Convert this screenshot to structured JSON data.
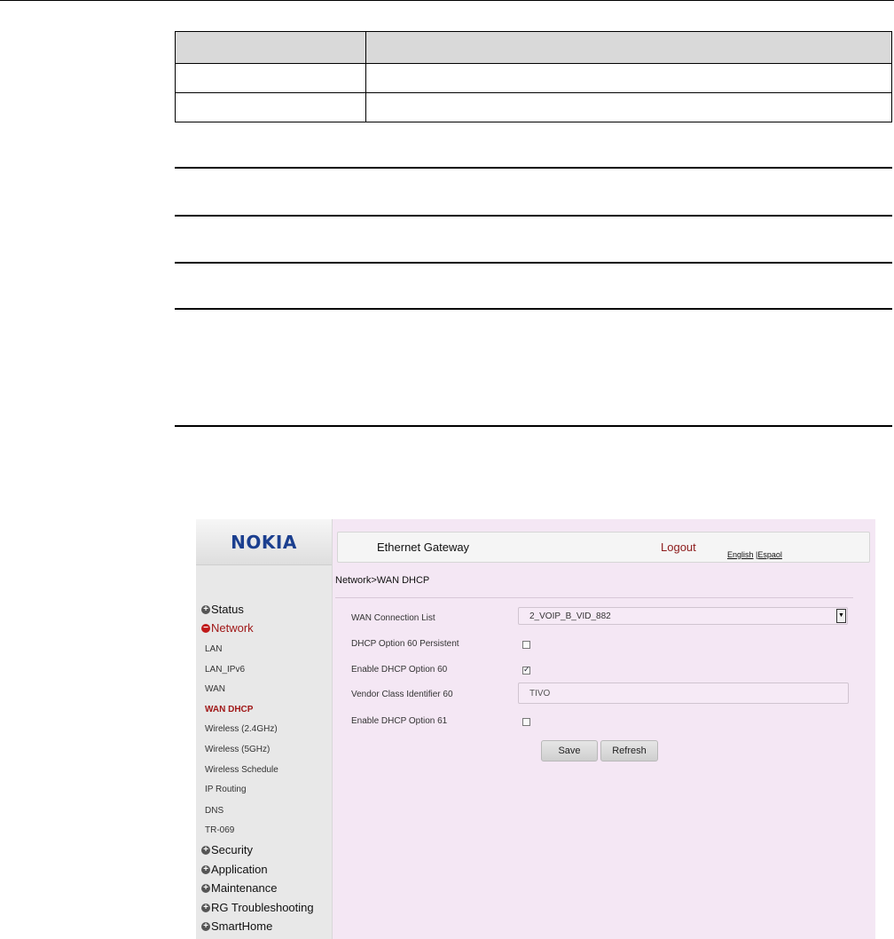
{
  "app": {
    "logo": "NOKIA",
    "title": "Ethernet Gateway",
    "logout": "Logout",
    "lang_english": "English",
    "lang_sep": " |",
    "lang_spanish": "Espaol"
  },
  "breadcrumb": "Network>WAN DHCP",
  "sidebar": {
    "status": "Status",
    "network": "Network",
    "sub": [
      "LAN",
      "LAN_IPv6",
      "WAN",
      "WAN DHCP",
      "Wireless (2.4GHz)",
      "Wireless (5GHz)",
      "Wireless Schedule",
      "IP Routing",
      "DNS",
      "TR-069"
    ],
    "active_sub": "WAN DHCP",
    "security": "Security",
    "application": "Application",
    "maintenance": "Maintenance",
    "troubleshooting": "RG Troubleshooting",
    "smarthome": "SmartHome"
  },
  "form": {
    "wan_list_label": "WAN Connection List",
    "wan_list_value": "2_VOIP_B_VID_882",
    "opt60_persistent_label": "DHCP Option 60 Persistent",
    "opt60_persistent_checked": false,
    "enable_opt60_label": "Enable DHCP Option 60",
    "enable_opt60_checked": true,
    "vendor_class_label": "Vendor Class Identifier 60",
    "vendor_class_value": "TIVO",
    "enable_opt61_label": "Enable DHCP Option 61",
    "enable_opt61_checked": false
  },
  "buttons": {
    "save": "Save",
    "refresh": "Refresh"
  },
  "colors": {
    "content_bg": "#f4e7f4",
    "sidebar_bg": "#e8e8e8",
    "active": "#a01818",
    "logo": "#1b3f8f"
  }
}
